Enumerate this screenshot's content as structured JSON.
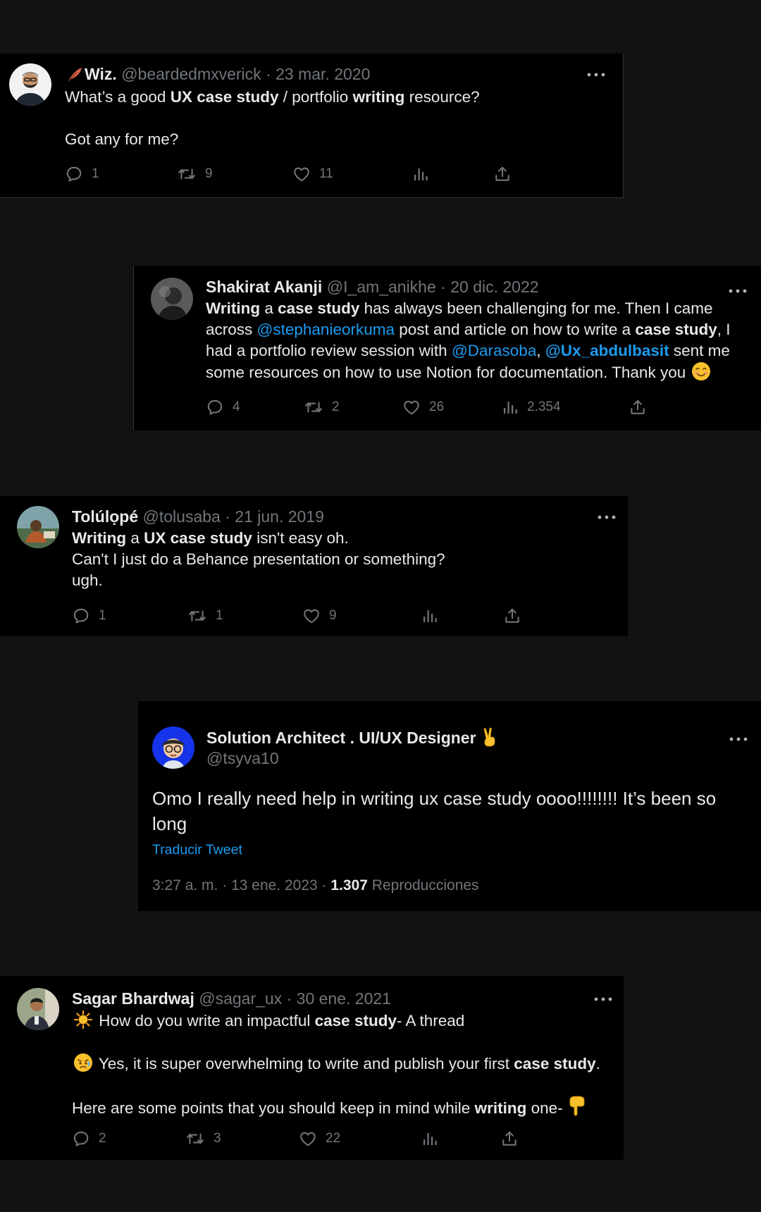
{
  "colors": {
    "page_background": "#121212",
    "card_background": "#000000",
    "text_primary": "#e7e9ea",
    "text_secondary": "#71767b",
    "link": "#1d9bf0"
  },
  "tweets": [
    {
      "name": "Wiz.",
      "name_prefix_icon": "feather-emoji",
      "handle": "@beardedmxverick",
      "date": "23 mar. 2020",
      "text": {
        "s1": "What’s a good ",
        "b1": "UX case study",
        "s2": " / portfolio ",
        "b2": "writing",
        "s3": " resource?",
        "line2": "Got any for me?"
      },
      "actions": {
        "replies": "1",
        "retweets": "9",
        "likes": "11",
        "views": ""
      }
    },
    {
      "name": "Shakirat Akanji",
      "handle": "@I_am_anikhe",
      "date": "20 dic. 2022",
      "text": {
        "b1": "Writing",
        "s1": " a ",
        "b2": "case study",
        "s2": " has always been challenging for me. Then I came across ",
        "m1": "@stephanieorkuma",
        "s3": " post and article on how to write a ",
        "b3": "case study",
        "s4": ", I had a portfolio review session with ",
        "m2": "@Darasoba",
        "s5": ", ",
        "m3": "@Ux_abdulbasit",
        "s6": " sent me some resources on how to use Notion for documentation. Thank you",
        "end_emoji": "smiling-face-emoji"
      },
      "actions": {
        "replies": "4",
        "retweets": "2",
        "likes": "26",
        "views": "2.354"
      }
    },
    {
      "name": "Tolúlọpé",
      "handle": "@tolusaba",
      "date": "21 jun. 2019",
      "text": {
        "b1": "Writing",
        "s1": " a ",
        "b2": "UX case study",
        "s2": " isn't easy oh.",
        "line2": "Can't I just do a Behance presentation or something?",
        "line3": "ugh."
      },
      "actions": {
        "replies": "1",
        "retweets": "1",
        "likes": "9",
        "views": ""
      }
    },
    {
      "name": "Solution Architect . UI/UX Designer",
      "name_suffix_icon": "victory-hand-emoji",
      "handle": "@tsyva10",
      "text": "Omo I really need help in writing ux case study oooo!!!!!!!! It’s been so long",
      "translate": "Traducir Tweet",
      "time": "3:27 a. m.",
      "date": "13 ene. 2023",
      "views_count": "1.307",
      "views_label": "Reproducciones",
      "sep": "·"
    },
    {
      "name": "Sagar Bhardwaj",
      "handle": "@sagar_ux",
      "date": "30 ene. 2021",
      "text": {
        "l1_emoji": "sun-emoji",
        "l1_s1": " How do you write an impactful ",
        "l1_b1": "case study",
        "l1_s2": "- A thread",
        "l2_emoji": "sad-relieved-face-emoji",
        "l2_s1": " Yes, it is super overwhelming to write and publish your first ",
        "l2_b1": "case study",
        "l2_s2": ".",
        "l3_s1": "Here are some points that you should keep in mind while ",
        "l3_b1": "writing",
        "l3_s2": " one- ",
        "l3_emoji": "pointing-down-emoji"
      },
      "actions": {
        "replies": "2",
        "retweets": "3",
        "likes": "22",
        "views": ""
      }
    }
  ],
  "separator": "·"
}
